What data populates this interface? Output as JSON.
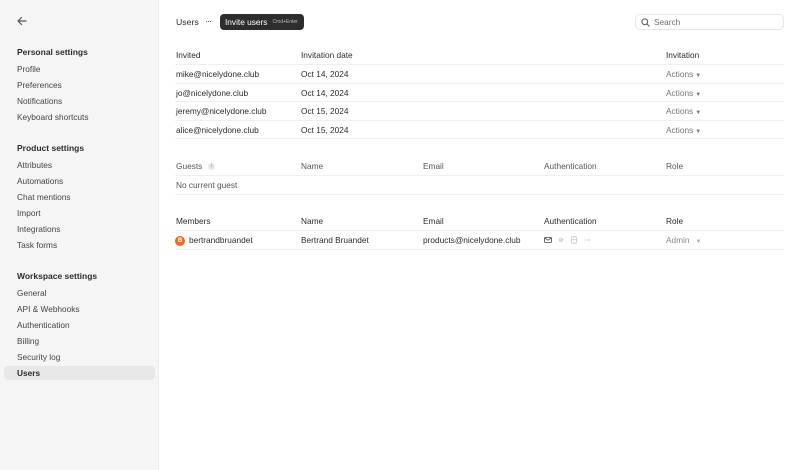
{
  "sidebar": {
    "back_icon": "arrow-left-icon",
    "sections": [
      {
        "title": "Personal settings",
        "items": [
          "Profile",
          "Preferences",
          "Notifications",
          "Keyboard shortcuts"
        ]
      },
      {
        "title": "Product settings",
        "items": [
          "Attributes",
          "Automations",
          "Chat mentions",
          "Import",
          "Integrations",
          "Task forms"
        ]
      },
      {
        "title": "Workspace settings",
        "items": [
          "General",
          "API & Webhooks",
          "Authentication",
          "Billing",
          "Security log",
          "Users"
        ]
      }
    ],
    "active_item": "Users"
  },
  "header": {
    "title": "Users",
    "more_label": "···",
    "invite_label": "Invite users",
    "invite_shortcut": "Cmd+Enter",
    "search_placeholder": "Search"
  },
  "invitations": {
    "headers": {
      "invited": "Invited",
      "date": "Invitation date",
      "invitation": "Invitation"
    },
    "rows": [
      {
        "email": "mike@nicelydone.club",
        "date": "Oct 14, 2024",
        "action": "Actions"
      },
      {
        "email": "jo@nicelydone.club",
        "date": "Oct 14, 2024",
        "action": "Actions"
      },
      {
        "email": "jeremy@nicelydone.club",
        "date": "Oct 15, 2024",
        "action": "Actions"
      },
      {
        "email": "alice@nicelydone.club",
        "date": "Oct 15, 2024",
        "action": "Actions"
      }
    ]
  },
  "guests": {
    "headers": {
      "guests": "Guests",
      "name": "Name",
      "email": "Email",
      "auth": "Authentication",
      "role": "Role"
    },
    "info_glyph": "i",
    "empty": "No current guest"
  },
  "members": {
    "headers": {
      "members": "Members",
      "name": "Name",
      "email": "Email",
      "auth": "Authentication",
      "role": "Role"
    },
    "rows": [
      {
        "avatar_initial": "B",
        "username": "bertrandbruandet",
        "name": "Bertrand Bruandet",
        "email": "products@nicelydone.club",
        "role": "Admin"
      }
    ]
  },
  "colors": {
    "accent": "#2d2d2d",
    "avatar": "#f06a1d",
    "active_nav": "#e8e8e8"
  }
}
